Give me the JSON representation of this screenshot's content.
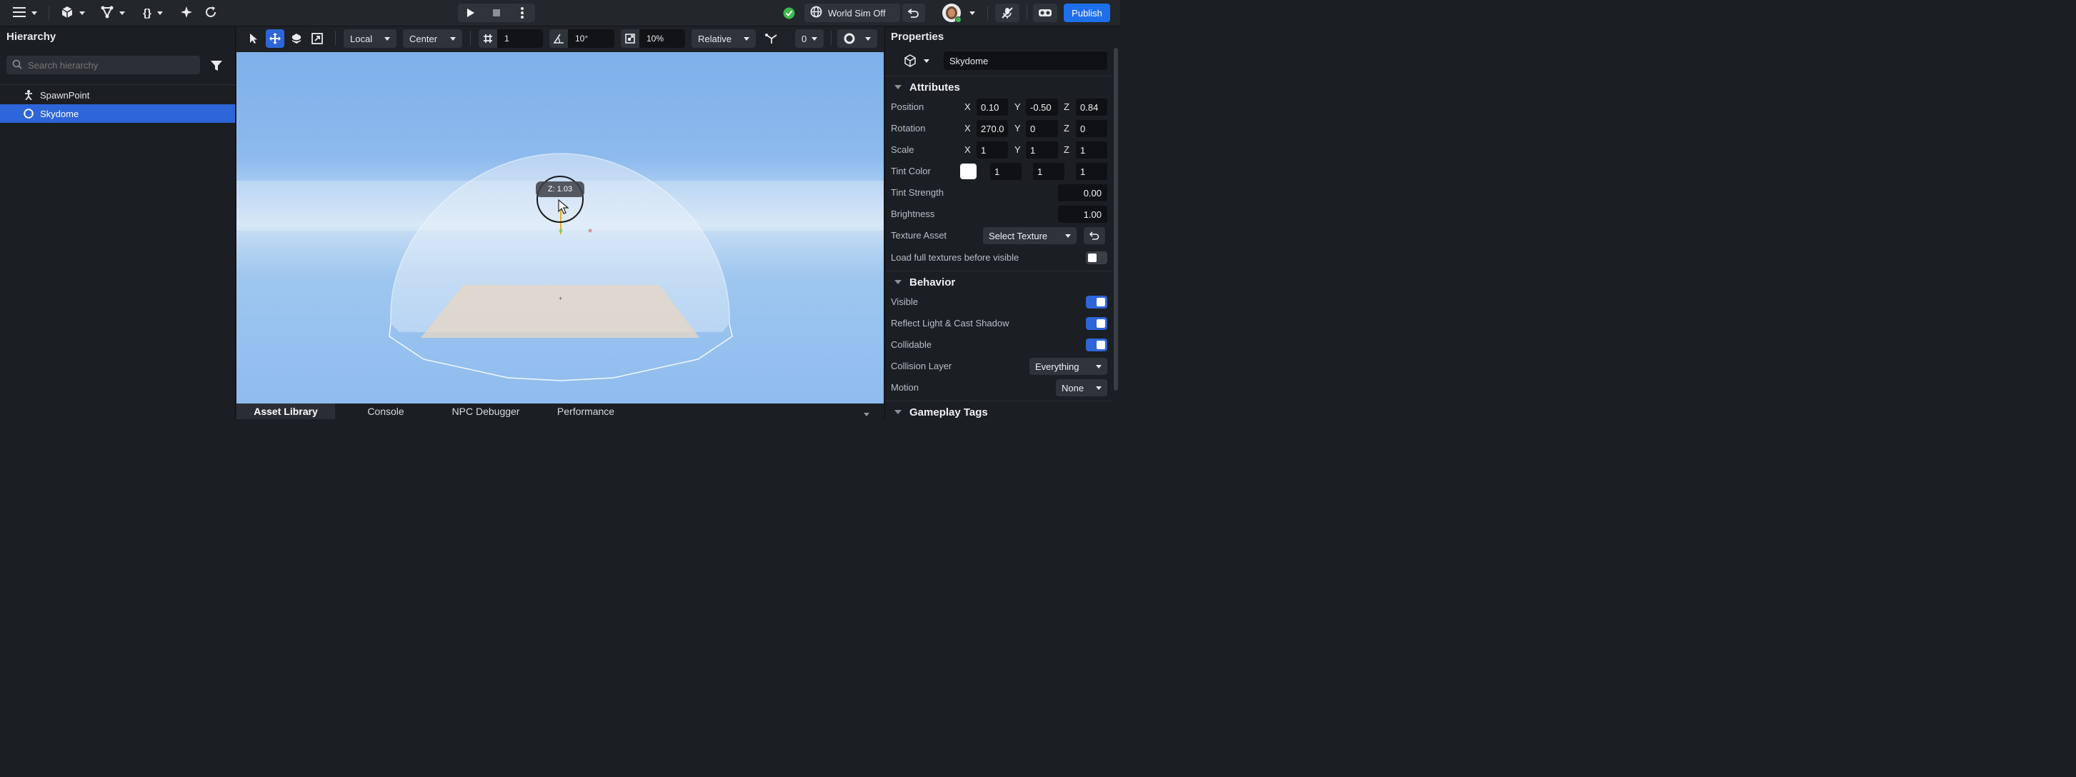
{
  "topbar": {
    "world_sim_label": "World Sim Off",
    "publish_label": "Publish",
    "status_color": "#3fb950",
    "accent_color": "#1f6feb"
  },
  "hierarchy": {
    "title": "Hierarchy",
    "search_placeholder": "Search hierarchy",
    "items": [
      {
        "label": "SpawnPoint",
        "icon": "spawn-point-icon",
        "selected": false
      },
      {
        "label": "Skydome",
        "icon": "skydome-icon",
        "selected": true
      }
    ]
  },
  "viewport_toolbar": {
    "space_mode": "Local",
    "pivot_mode": "Center",
    "grid_snap_value": "1",
    "rotation_snap_value": "10°",
    "scale_snap_value": "10%",
    "snap_mode": "Relative",
    "partial_value": "0"
  },
  "viewport": {
    "gizmo_tooltip": "Z: 1.03"
  },
  "bottom_tabs": [
    "Asset Library",
    "Console",
    "NPC Debugger",
    "Performance"
  ],
  "properties": {
    "title": "Properties",
    "entity_name": "Skydome",
    "sections": {
      "attributes": "Attributes",
      "behavior": "Behavior",
      "gameplay_tags": "Gameplay Tags"
    },
    "position": {
      "label": "Position",
      "x": "0.10",
      "y": "-0.50",
      "z": "0.84"
    },
    "rotation": {
      "label": "Rotation",
      "x": "270.0",
      "y": "0",
      "z": "0"
    },
    "scale": {
      "label": "Scale",
      "x": "1",
      "y": "1",
      "z": "1"
    },
    "tint_color": {
      "label": "Tint Color",
      "r": "1",
      "g": "1",
      "b": "1",
      "swatch": "#ffffff"
    },
    "tint_strength": {
      "label": "Tint Strength",
      "value": "0.00"
    },
    "brightness": {
      "label": "Brightness",
      "value": "1.00"
    },
    "texture_asset": {
      "label": "Texture Asset",
      "value": "Select Texture"
    },
    "load_full_textures": {
      "label": "Load full textures before visible",
      "on": false
    },
    "visible": {
      "label": "Visible",
      "on": true
    },
    "reflect_light": {
      "label": "Reflect Light & Cast Shadow",
      "on": true
    },
    "collidable": {
      "label": "Collidable",
      "on": true
    },
    "collision_layer": {
      "label": "Collision Layer",
      "value": "Everything"
    },
    "motion": {
      "label": "Motion",
      "value": "None"
    },
    "axis_labels": {
      "x": "X",
      "y": "Y",
      "z": "Z"
    }
  }
}
